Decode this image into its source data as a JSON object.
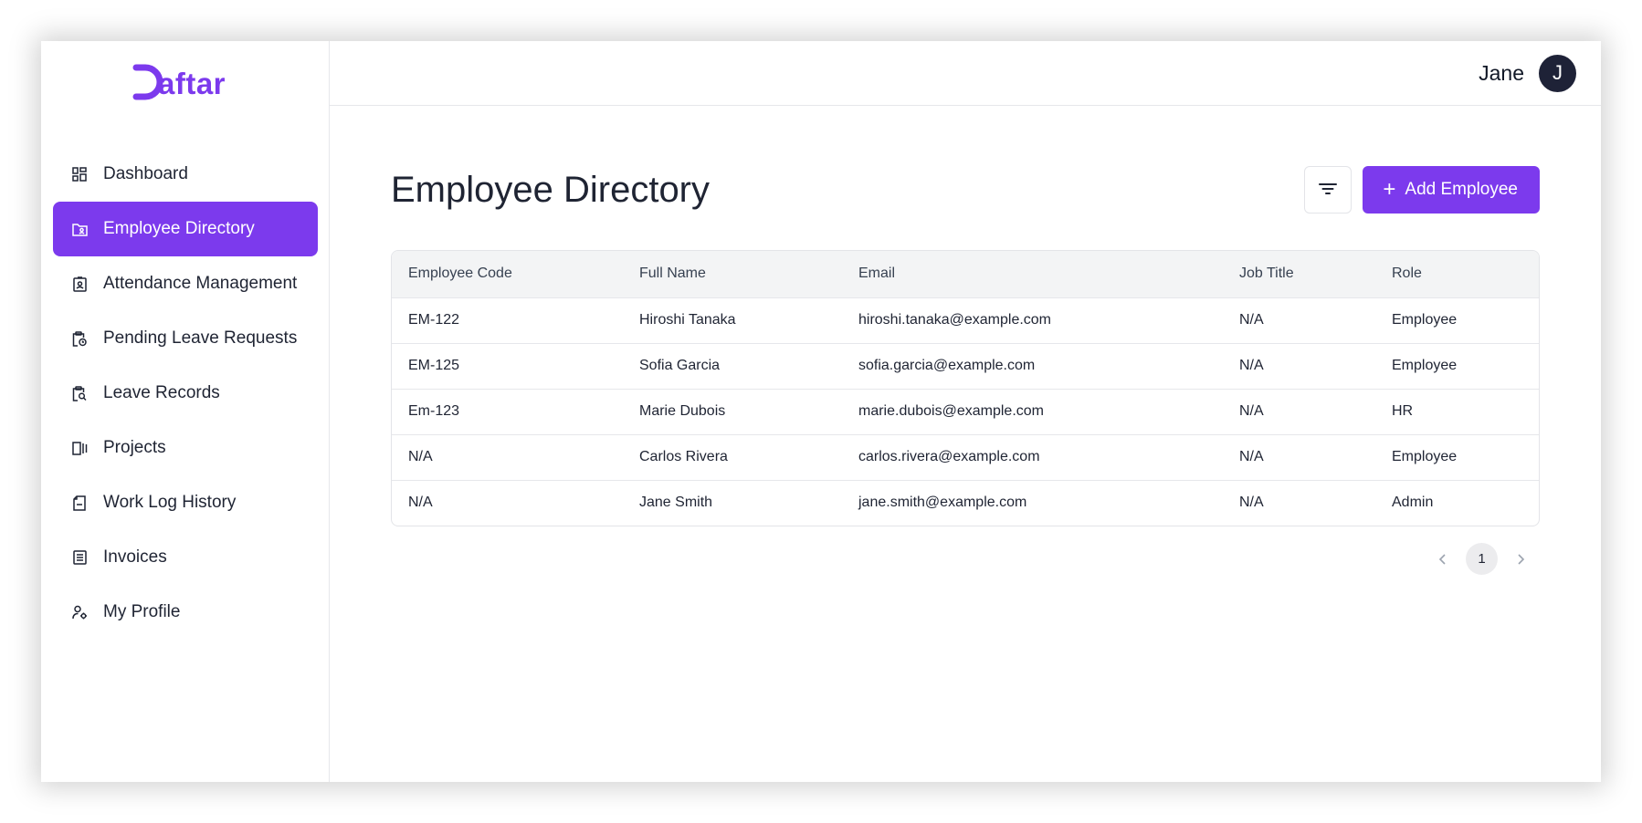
{
  "app": {
    "logo_text": "Daftar",
    "brand_color": "#7c3aed"
  },
  "header": {
    "user_name": "Jane",
    "avatar_initial": "J"
  },
  "sidebar": {
    "items": [
      {
        "label": "Dashboard",
        "icon": "dashboard-icon",
        "active": false
      },
      {
        "label": "Employee Directory",
        "icon": "folder-user-icon",
        "active": true
      },
      {
        "label": "Attendance Management",
        "icon": "id-badge-icon",
        "active": false
      },
      {
        "label": "Pending Leave Requests",
        "icon": "clipboard-clock-icon",
        "active": false
      },
      {
        "label": "Leave Records",
        "icon": "clipboard-search-icon",
        "active": false
      },
      {
        "label": "Projects",
        "icon": "projects-icon",
        "active": false
      },
      {
        "label": "Work Log History",
        "icon": "document-icon",
        "active": false
      },
      {
        "label": "Invoices",
        "icon": "invoice-icon",
        "active": false
      },
      {
        "label": "My Profile",
        "icon": "user-gear-icon",
        "active": false
      }
    ]
  },
  "main": {
    "title": "Employee Directory",
    "filter_icon": "filter-icon",
    "add_button_label": "Add Employee",
    "table": {
      "columns": [
        "Employee Code",
        "Full Name",
        "Email",
        "Job Title",
        "Role"
      ],
      "rows": [
        [
          "EM-122",
          "Hiroshi Tanaka",
          "hiroshi.tanaka@example.com",
          "N/A",
          "Employee"
        ],
        [
          "EM-125",
          "Sofia Garcia",
          "sofia.garcia@example.com",
          "N/A",
          "Employee"
        ],
        [
          "Em-123",
          "Marie Dubois",
          "marie.dubois@example.com",
          "N/A",
          "HR"
        ],
        [
          "N/A",
          "Carlos Rivera",
          "carlos.rivera@example.com",
          "N/A",
          "Employee"
        ],
        [
          "N/A",
          "Jane Smith",
          "jane.smith@example.com",
          "N/A",
          "Admin"
        ]
      ]
    },
    "pagination": {
      "current_page": "1"
    }
  }
}
